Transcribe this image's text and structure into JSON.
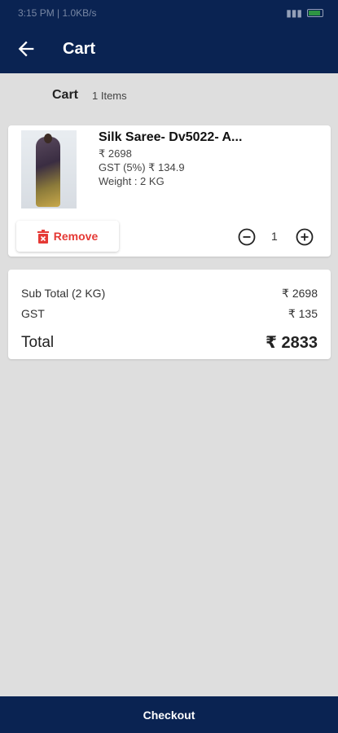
{
  "status_bar": {
    "time": "3:15 PM | 1.0KB/s"
  },
  "app_bar": {
    "title": "Cart",
    "back_icon": "arrow-left-icon"
  },
  "cart_header": {
    "title": "Cart",
    "count": "1 Items"
  },
  "item": {
    "name": "Silk Saree- Dv5022- A...",
    "price": "₹ 2698",
    "gst": "GST (5%) ₹ 134.9",
    "weight": "Weight : 2 KG",
    "remove_label": "Remove",
    "quantity": "1"
  },
  "summary": {
    "subtotal_label": "Sub Total (2 KG)",
    "subtotal_value": "₹ 2698",
    "gst_label": "GST",
    "gst_value": "₹ 135",
    "total_label": "Total",
    "total_value": "₹ 2833"
  },
  "checkout": {
    "label": "Checkout"
  },
  "colors": {
    "primary": "#0a2352",
    "remove": "#e53935",
    "background": "#dedede"
  }
}
